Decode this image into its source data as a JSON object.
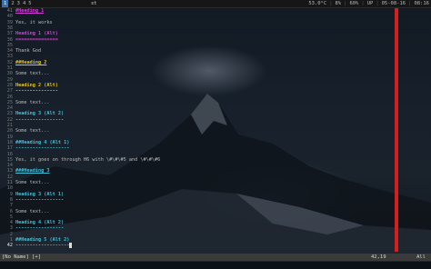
{
  "topbar": {
    "workspaces": [
      "1",
      "2",
      "3",
      "4",
      "5"
    ],
    "active_workspace": "1",
    "title": "st",
    "indicators": [
      "53.0°C",
      "8%",
      "60%",
      "UP",
      "05-08-16",
      "08:16"
    ]
  },
  "editor": {
    "lines": [
      {
        "n": "41",
        "text": "#Heading 1",
        "style": "h1u"
      },
      {
        "n": "40",
        "text": "",
        "style": "txt"
      },
      {
        "n": "39",
        "text": "Yes, it works",
        "style": "txt"
      },
      {
        "n": "38",
        "text": "",
        "style": "txt"
      },
      {
        "n": "37",
        "text": "Heading 1 (Alt)",
        "style": "h1"
      },
      {
        "n": "36",
        "text": "===============",
        "style": "h1"
      },
      {
        "n": "35",
        "text": "",
        "style": "txt"
      },
      {
        "n": "34",
        "text": "Thank God",
        "style": "txt"
      },
      {
        "n": "33",
        "text": "",
        "style": "txt"
      },
      {
        "n": "32",
        "text": "##Heading 2",
        "style": "h2u"
      },
      {
        "n": "31",
        "text": "",
        "style": "txt"
      },
      {
        "n": "30",
        "text": "Some text...",
        "style": "txt"
      },
      {
        "n": "29",
        "text": "",
        "style": "txt"
      },
      {
        "n": "28",
        "text": "Heading 2 (Alt)",
        "style": "h2"
      },
      {
        "n": "27",
        "text": "---------------",
        "style": "h2"
      },
      {
        "n": "26",
        "text": "",
        "style": "txt"
      },
      {
        "n": "25",
        "text": "Some text...",
        "style": "txt"
      },
      {
        "n": "24",
        "text": "",
        "style": "txt"
      },
      {
        "n": "23",
        "text": "Heading 3 (Alt 2)",
        "style": "h3"
      },
      {
        "n": "22",
        "text": "-----------------",
        "style": "h3"
      },
      {
        "n": "21",
        "text": "",
        "style": "txt"
      },
      {
        "n": "20",
        "text": "Some text...",
        "style": "txt"
      },
      {
        "n": "19",
        "text": "",
        "style": "txt"
      },
      {
        "n": "18",
        "text": "##Heading 4 (Alt 1)",
        "style": "h3"
      },
      {
        "n": "17",
        "text": "-------------------",
        "style": "h3"
      },
      {
        "n": "16",
        "text": "",
        "style": "txt"
      },
      {
        "n": "15",
        "text": "Yes, it goes on through H6 with \\#\\#\\#5 and \\#\\#\\#6",
        "style": "txt"
      },
      {
        "n": "14",
        "text": "",
        "style": "txt"
      },
      {
        "n": "13",
        "text": "###Heading 3",
        "style": "h3u"
      },
      {
        "n": "12",
        "text": "",
        "style": "txt"
      },
      {
        "n": "11",
        "text": "Some text...",
        "style": "txt"
      },
      {
        "n": "10",
        "text": "",
        "style": "txt"
      },
      {
        "n": "9",
        "text": "Heading 3 (Alt 1)",
        "style": "h3"
      },
      {
        "n": "8",
        "text": "-----------------",
        "style": "h3"
      },
      {
        "n": "7",
        "text": "",
        "style": "txt"
      },
      {
        "n": "6",
        "text": "Some text...",
        "style": "txt"
      },
      {
        "n": "5",
        "text": "",
        "style": "txt"
      },
      {
        "n": "4",
        "text": "Heading 4 (Alt 2)",
        "style": "h3"
      },
      {
        "n": "3",
        "text": "-----------------",
        "style": "h3"
      },
      {
        "n": "2",
        "text": "",
        "style": "txt"
      },
      {
        "n": "1",
        "text": "##Heading 5 (Alt 2)",
        "style": "h3"
      },
      {
        "n": "42",
        "text": "-------------------",
        "style": "h3",
        "current": true
      }
    ]
  },
  "statusline": {
    "buffer_name": "[No Name]",
    "modified": "[+]",
    "position": "42,19",
    "scroll": "All"
  },
  "colors": {
    "h1": "#d43bd9",
    "h2": "#e5c018",
    "h3": "#3fc0d8",
    "colorcolumn": "#d51f1f",
    "statusline_bg": "#3a3a3a"
  }
}
